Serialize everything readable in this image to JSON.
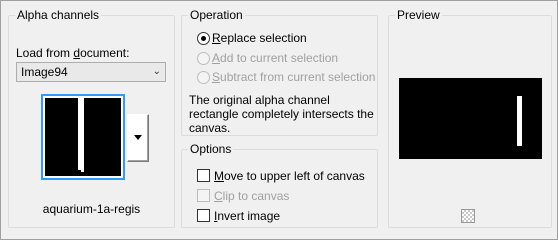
{
  "alpha_channels": {
    "title": "Alpha channels",
    "load_label_prefix": "Load from ",
    "load_label_underlined": "d",
    "load_label_suffix": "ocument:",
    "document_value": "Image94",
    "image_name": "aquarium-1a-regis"
  },
  "operation": {
    "title": "Operation",
    "options": [
      {
        "underlined": "R",
        "rest": "eplace selection",
        "checked": true,
        "enabled": true
      },
      {
        "underlined": "A",
        "rest": "dd to current selection",
        "checked": false,
        "enabled": false
      },
      {
        "underlined": "S",
        "rest": "ubtract from current selection",
        "checked": false,
        "enabled": false
      }
    ],
    "description": "The original alpha channel rectangle completely intersects the canvas."
  },
  "options": {
    "title": "Options",
    "items": [
      {
        "underlined": "M",
        "rest": "ove to upper left of canvas",
        "checked": false,
        "enabled": true
      },
      {
        "underlined": "C",
        "rest": "lip to canvas",
        "checked": false,
        "enabled": false
      },
      {
        "underlined": "I",
        "rest": "nvert image",
        "checked": false,
        "enabled": true
      }
    ]
  },
  "preview": {
    "title": "Preview",
    "nav_icon": "checker-navigate-icon"
  },
  "colors": {
    "selection_accent": "#3399ff",
    "disabled_text": "#a0a0a0"
  }
}
